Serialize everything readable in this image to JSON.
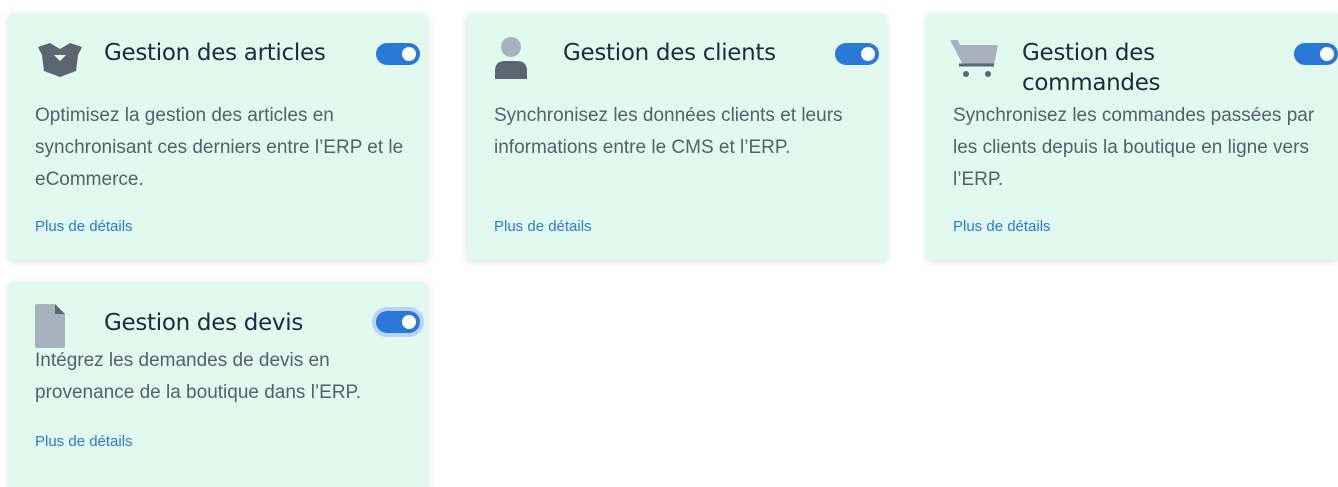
{
  "cards": [
    {
      "title": "Gestion des articles",
      "icon": "box-icon",
      "enabled": true,
      "description": "Optimisez la gestion des articles en synchronisant ces derniers entre l’ERP et le eCommerce.",
      "link": "Plus de détails"
    },
    {
      "title": "Gestion des clients",
      "icon": "user-icon",
      "enabled": true,
      "description": "Synchronisez les données clients et leurs informations entre le CMS et l’ERP.",
      "link": "Plus de détails"
    },
    {
      "title": "Gestion des commandes",
      "icon": "cart-icon",
      "enabled": true,
      "description": "Synchronisez les commandes passées par les clients depuis la boutique en ligne vers l’ERP.",
      "link": "Plus de détails"
    },
    {
      "title": "Gestion des devis",
      "icon": "document-icon",
      "enabled": true,
      "description": "Intégrez les demandes de devis en provenance de la boutique dans l’ERP.",
      "link": "Plus de détails"
    }
  ],
  "colors": {
    "card_background": "#e1f9ee",
    "toggle_on": "#2a78d8",
    "link": "#2a7ad9",
    "title": "#1e2b38",
    "icon": "#5b6670"
  }
}
